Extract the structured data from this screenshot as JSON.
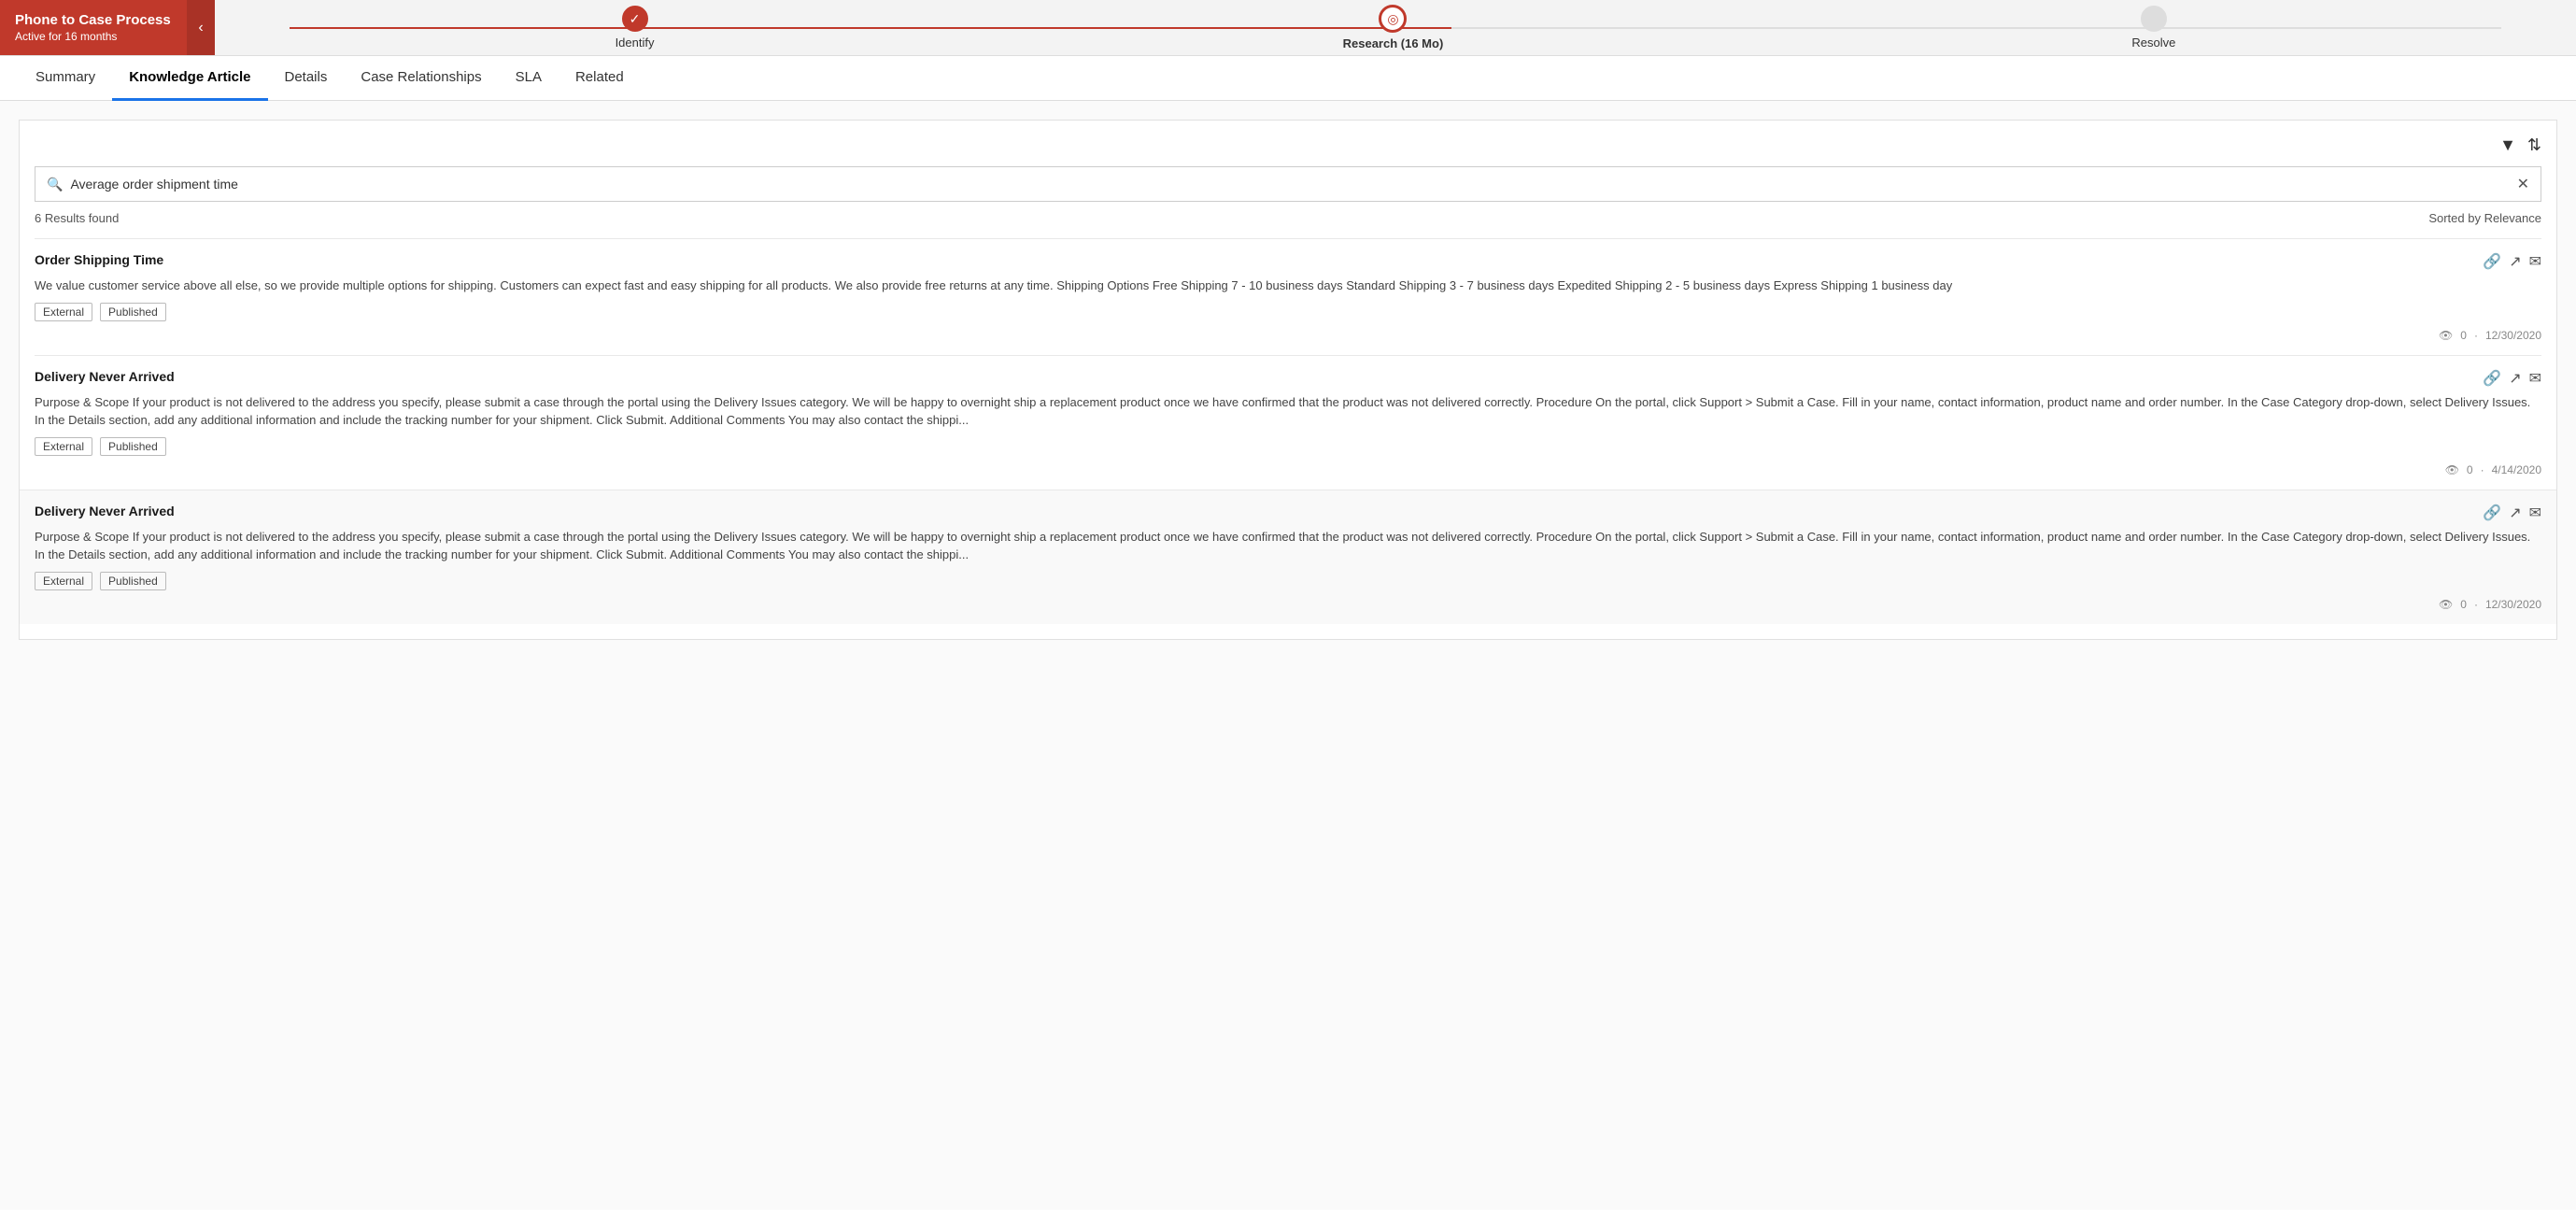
{
  "process": {
    "title": "Phone to Case Process",
    "subtitle": "Active for 16 months",
    "collapse_label": "‹",
    "steps": [
      {
        "id": "identify",
        "label": "Identify",
        "state": "completed"
      },
      {
        "id": "research",
        "label": "Research  (16 Mo)",
        "state": "active"
      },
      {
        "id": "resolve",
        "label": "Resolve",
        "state": "inactive"
      }
    ]
  },
  "tabs": [
    {
      "id": "summary",
      "label": "Summary",
      "active": false
    },
    {
      "id": "knowledge-article",
      "label": "Knowledge Article",
      "active": true
    },
    {
      "id": "details",
      "label": "Details",
      "active": false
    },
    {
      "id": "case-relationships",
      "label": "Case Relationships",
      "active": false
    },
    {
      "id": "sla",
      "label": "SLA",
      "active": false
    },
    {
      "id": "related",
      "label": "Related",
      "active": false
    }
  ],
  "search": {
    "placeholder": "Average order shipment time",
    "value": "Average order shipment time"
  },
  "results": {
    "count_label": "6 Results found",
    "sort_label": "Sorted by Relevance"
  },
  "articles": [
    {
      "id": "article-1",
      "title": "Order Shipping Time",
      "body": "We value customer service above all else, so we provide multiple options for shipping. Customers can expect fast and easy shipping for all products. We also provide free returns at any time. Shipping Options Free Shipping 7 - 10 business days Standard Shipping 3 - 7 business days Expedited Shipping 2 - 5 business days Express Shipping 1 business day",
      "tags": [
        "External",
        "Published"
      ],
      "views": "0",
      "date": "12/30/2020",
      "alt": false
    },
    {
      "id": "article-2",
      "title": "Delivery Never Arrived",
      "body": "Purpose & Scope If your product is not delivered to the address you specify, please submit a case through the portal using the Delivery Issues category. We will be happy to overnight ship a replacement product once we have confirmed that the product was not delivered correctly. Procedure On the portal, click Support > Submit a Case. Fill in your name, contact information, product name and order number. In the Case Category drop-down, select Delivery Issues. In the Details section, add any additional information and include the tracking number for your shipment. Click Submit. Additional Comments You may also contact the shippi...",
      "tags": [
        "External",
        "Published"
      ],
      "views": "0",
      "date": "4/14/2020",
      "alt": false
    },
    {
      "id": "article-3",
      "title": "Delivery Never Arrived",
      "body": "Purpose & Scope If your product is not delivered to the address you specify, please submit a case through the portal using the Delivery Issues category. We will be happy to overnight ship a replacement product once we have confirmed that the product was not delivered correctly. Procedure On the portal, click Support > Submit a Case. Fill in your name, contact information, product name and order number. In the Case Category drop-down, select Delivery Issues. In the Details section, add any additional information and include the tracking number for your shipment. Click Submit. Additional Comments You may also contact the shippi...",
      "tags": [
        "External",
        "Published"
      ],
      "views": "0",
      "date": "12/30/2020",
      "alt": true
    }
  ],
  "icons": {
    "filter": "▼",
    "sort": "⇅",
    "link": "🔗",
    "external": "↗",
    "email": "✉",
    "eye": "👁",
    "search": "🔍",
    "clear": "✕",
    "chevron_left": "‹"
  }
}
